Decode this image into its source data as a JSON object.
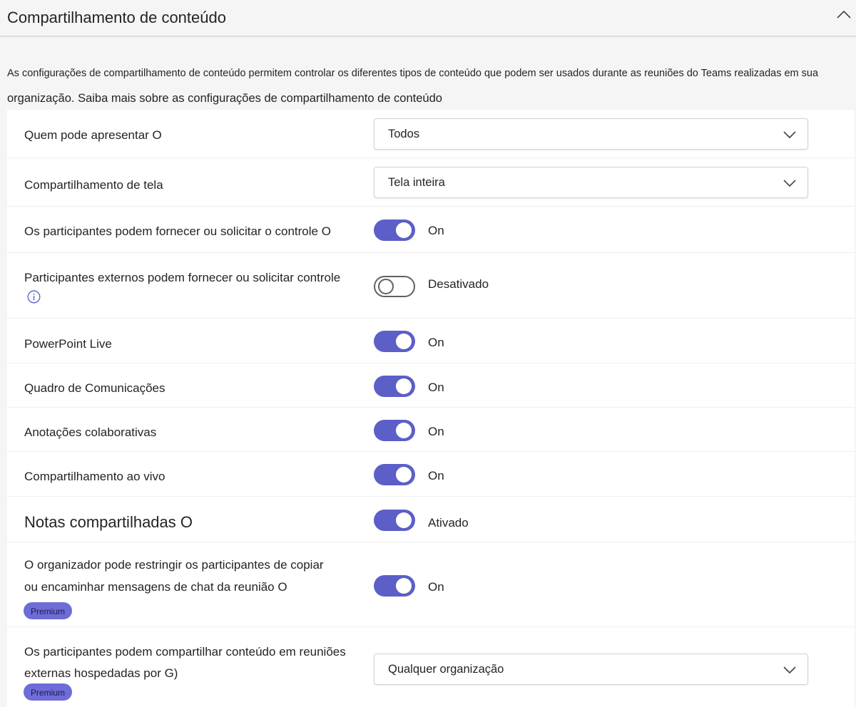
{
  "header": {
    "title": "Compartilhamento de conteúdo",
    "collapse_icon": "chevron-up-icon"
  },
  "description": {
    "line1": "As configurações de compartilhamento de conteúdo permitem controlar os diferentes tipos de conteúdo que podem ser usados durante as reuniões do Teams realizadas em sua",
    "line2": "organização. Saiba mais sobre as configurações de compartilhamento de conteúdo"
  },
  "settings": [
    {
      "label": "Quem pode apresentar O",
      "control": "dropdown",
      "value": "Todos"
    },
    {
      "label": "Compartilhamento de tela",
      "control": "dropdown",
      "value": "Tela inteira"
    },
    {
      "label": "Os participantes podem fornecer ou solicitar o controle O",
      "control": "toggle",
      "state": true,
      "state_label": "On"
    },
    {
      "label": "Participantes externos podem fornecer ou solicitar controle",
      "control": "toggle",
      "state": false,
      "state_label": "Desativado",
      "info_icon": "info-icon"
    },
    {
      "label": "PowerPoint Live",
      "control": "toggle",
      "state": true,
      "state_label": "On"
    },
    {
      "label": "Quadro de Comunicações",
      "control": "toggle",
      "state": true,
      "state_label": "On"
    },
    {
      "label": "Anotações colaborativas",
      "control": "toggle",
      "state": true,
      "state_label": "On"
    },
    {
      "label": "Compartilhamento ao vivo",
      "control": "toggle",
      "state": true,
      "state_label": "On"
    },
    {
      "label": "Notas compartilhadas O",
      "control": "toggle",
      "state": true,
      "state_label": "Ativado"
    },
    {
      "label_line1": "O organizador pode restringir os participantes de copiar",
      "label_line2": "ou encaminhar mensagens de chat da reunião O",
      "badge": "Premium",
      "control": "toggle",
      "state": true,
      "state_label": "On"
    },
    {
      "label_line1": "Os participantes podem compartilhar conteúdo em reuniões",
      "label_line2": "externas hospedadas por G)",
      "badge": "Premium",
      "control": "dropdown",
      "value": "Qualquer organização"
    }
  ],
  "colors": {
    "accent": "#5b5fc7",
    "badge": "#6e6cd6"
  }
}
